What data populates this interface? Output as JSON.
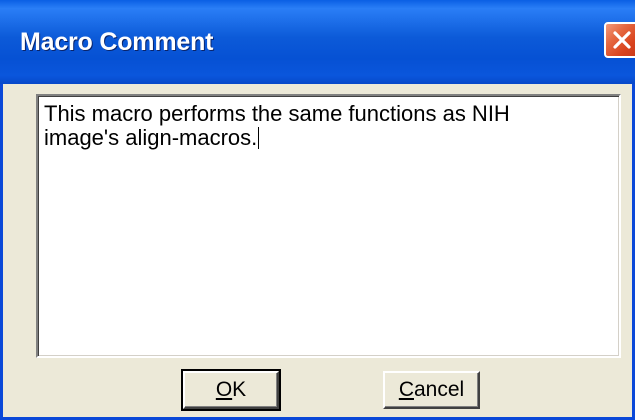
{
  "window": {
    "title": "Macro Comment",
    "close_icon": "close-icon",
    "accent_color": "#0a48d8",
    "close_color": "#e5673f"
  },
  "comment": {
    "text": "This macro performs the same functions as NIH\nimage's align-macros."
  },
  "buttons": {
    "ok": {
      "mnemonic": "O",
      "rest": "K"
    },
    "cancel": {
      "mnemonic": "C",
      "rest": "ancel"
    }
  }
}
